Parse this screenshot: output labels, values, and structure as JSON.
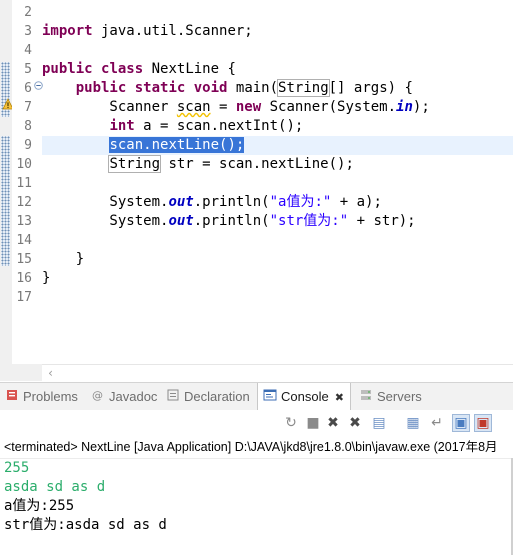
{
  "editor": {
    "line_numbers": [
      "2",
      "3",
      "4",
      "5",
      "6",
      "7",
      "8",
      "9",
      "10",
      "11",
      "12",
      "13",
      "14",
      "15",
      "16",
      "17"
    ],
    "lines": [
      [],
      [
        {
          "t": "import",
          "k": "kw"
        },
        {
          "t": " java.util.Scanner;"
        }
      ],
      [],
      [
        {
          "t": "public",
          "k": "kw"
        },
        {
          "t": " "
        },
        {
          "t": "class",
          "k": "kw"
        },
        {
          "t": " NextLine {"
        }
      ],
      [
        {
          "t": "    "
        },
        {
          "t": "public",
          "k": "kw"
        },
        {
          "t": " "
        },
        {
          "t": "static",
          "k": "kw"
        },
        {
          "t": " "
        },
        {
          "t": "void",
          "k": "kw"
        },
        {
          "t": " main("
        },
        {
          "t": "String",
          "k": "boxed"
        },
        {
          "t": "[] args) {"
        }
      ],
      [
        {
          "t": "        Scanner "
        },
        {
          "t": "scan",
          "k": "warn"
        },
        {
          "t": " = "
        },
        {
          "t": "new",
          "k": "kw"
        },
        {
          "t": " Scanner(System."
        },
        {
          "t": "in",
          "k": "fld"
        },
        {
          "t": ");"
        }
      ],
      [
        {
          "t": "        "
        },
        {
          "t": "int",
          "k": "kw"
        },
        {
          "t": " a = scan.nextInt();"
        }
      ],
      [
        {
          "t": "        "
        },
        {
          "t": "scan.nextLine();",
          "k": "sel"
        }
      ],
      [
        {
          "t": "        "
        },
        {
          "t": "String",
          "k": "boxed"
        },
        {
          "t": " str = scan.nextLine();"
        }
      ],
      [],
      [
        {
          "t": "        System."
        },
        {
          "t": "out",
          "k": "fld"
        },
        {
          "t": ".println("
        },
        {
          "t": "\"a值为:\"",
          "k": "str"
        },
        {
          "t": " + a);"
        }
      ],
      [
        {
          "t": "        System."
        },
        {
          "t": "out",
          "k": "fld"
        },
        {
          "t": ".println("
        },
        {
          "t": "\"str值为:\"",
          "k": "str"
        },
        {
          "t": " + str);"
        }
      ],
      [],
      [
        {
          "t": "    }"
        }
      ],
      [
        {
          "t": "}"
        }
      ],
      []
    ],
    "current_line_number": "9"
  },
  "tabs": [
    {
      "label": "Problems",
      "icon": "problems-icon",
      "active": false
    },
    {
      "label": "Javadoc",
      "icon": "javadoc-icon",
      "active": false
    },
    {
      "label": "Declaration",
      "icon": "declaration-icon",
      "active": false
    },
    {
      "label": "Console",
      "icon": "console-icon",
      "active": true
    },
    {
      "label": "Servers",
      "icon": "servers-icon",
      "active": false
    }
  ],
  "console_toolbar": [
    "debug-terminate-icon",
    "terminate-icon",
    "remove-launch-icon",
    "remove-all-terminated-icon",
    "clear-console-icon",
    "scroll-lock-icon",
    "word-wrap-icon",
    "show-console-icon",
    "pin-console-icon"
  ],
  "console": {
    "header": "<terminated> NextLine [Java Application] D:\\JAVA\\jkd8\\jre1.8.0\\bin\\javaw.exe (2017年8月",
    "lines": [
      {
        "text": "255",
        "type": "input"
      },
      {
        "text": "asda sd as d",
        "type": "input"
      },
      {
        "text": "a值为:255",
        "type": "output"
      },
      {
        "text": "str值为:asda sd as d",
        "type": "output"
      }
    ]
  },
  "colors": {
    "keyword": "#7f0055",
    "string": "#2a00ff",
    "field": "#0000c0",
    "selection": "#3875d7",
    "current_line": "#e8f2fe",
    "console_input": "#2bad6b"
  }
}
